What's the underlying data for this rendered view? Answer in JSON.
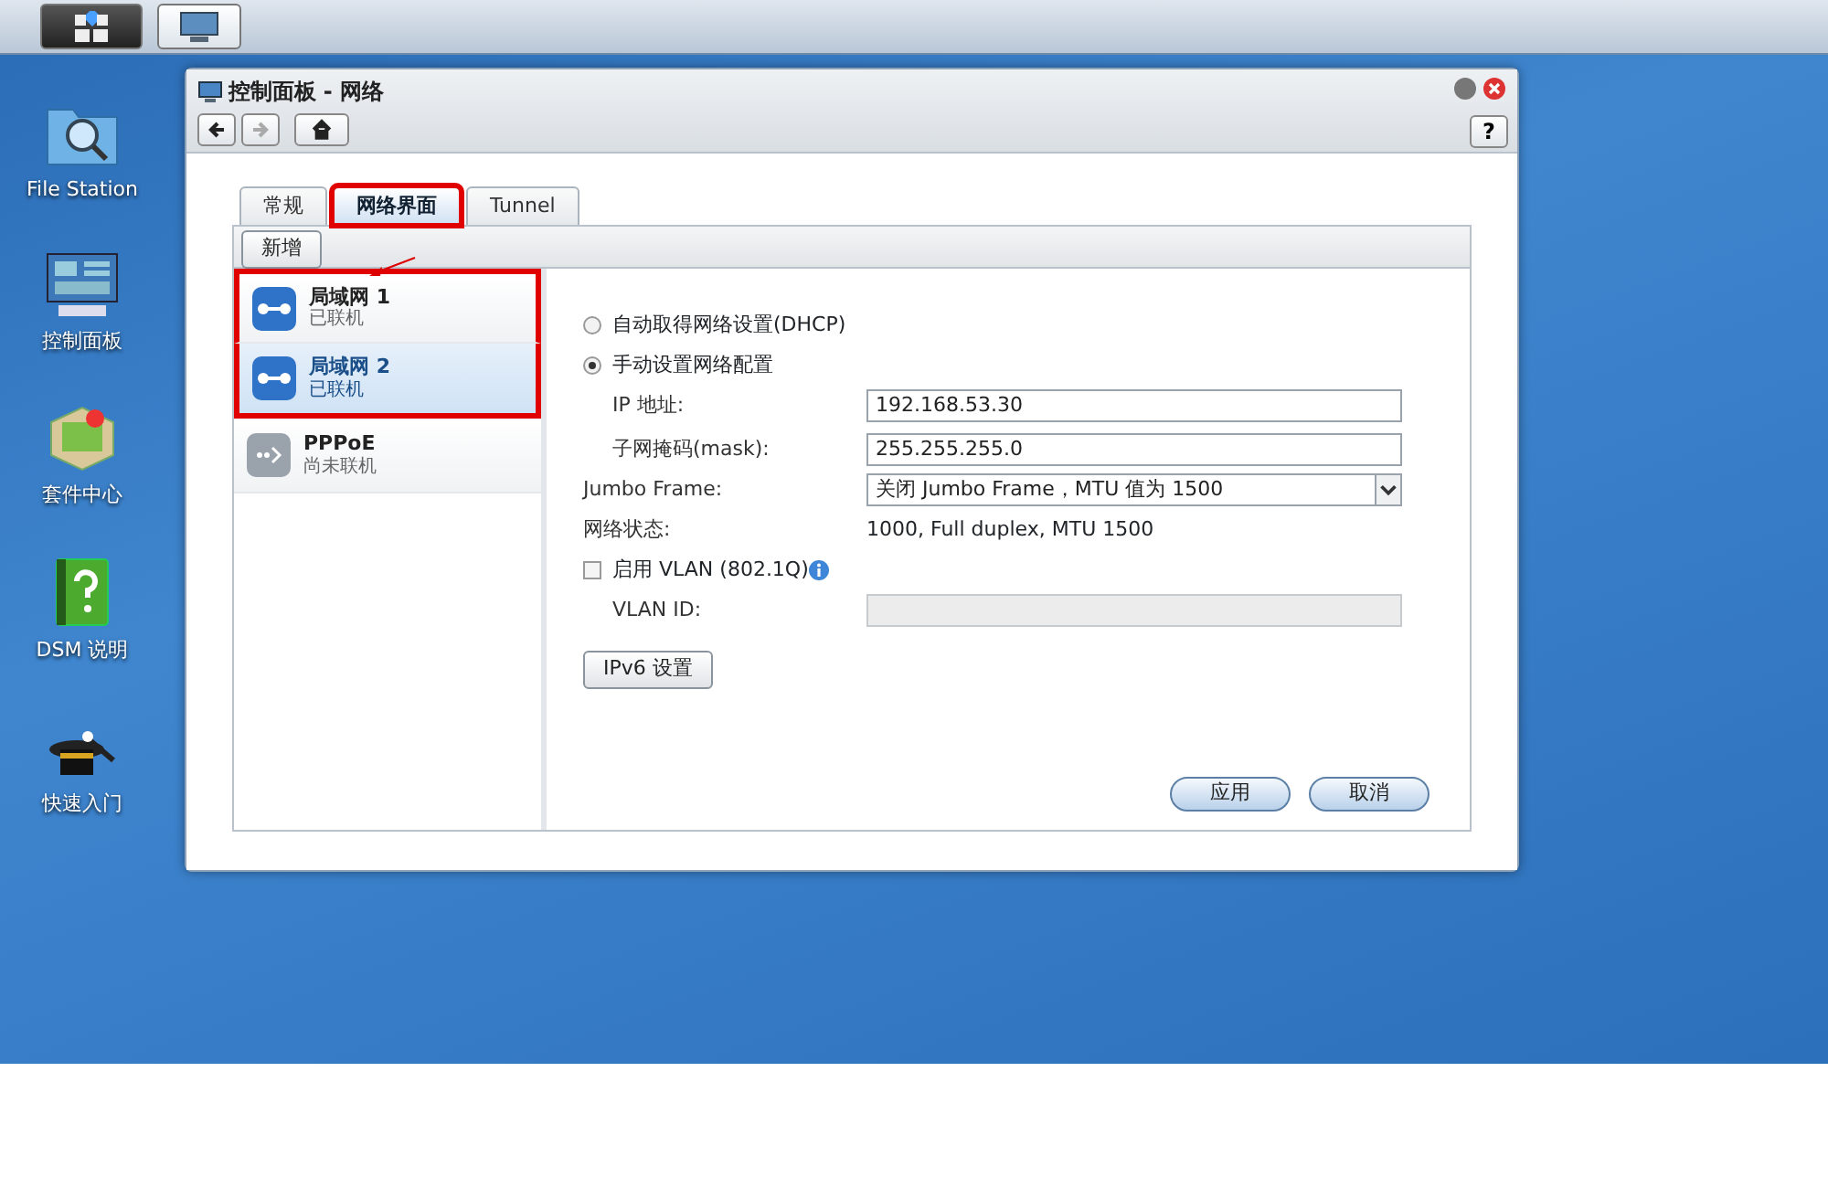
{
  "taskbar": {
    "buttons": [
      {
        "kind": "main-menu",
        "selected": true
      },
      {
        "kind": "control-panel",
        "selected": false
      }
    ]
  },
  "desktop_icons": [
    {
      "kind": "folder",
      "label": "File Station"
    },
    {
      "kind": "panel",
      "label": "控制面板"
    },
    {
      "kind": "package",
      "label": "套件中心"
    },
    {
      "kind": "help",
      "label": "DSM 说明"
    },
    {
      "kind": "hat",
      "label": "快速入门"
    }
  ],
  "window": {
    "title": "控制面板 - 网络",
    "help_button": "?",
    "nav": [
      {
        "kind": "back",
        "disabled": false
      },
      {
        "kind": "forward",
        "disabled": true
      },
      {
        "kind": "home",
        "disabled": false
      }
    ],
    "tabs": [
      {
        "label": "常规",
        "selected": false,
        "highlighted": false
      },
      {
        "label": "网络界面",
        "selected": true,
        "highlighted": true
      },
      {
        "label": "Tunnel",
        "selected": false,
        "highlighted": false
      }
    ],
    "toolbar": {
      "create_button": "新增"
    },
    "interfaces": [
      {
        "name": "局域网 1",
        "status": "已联机",
        "connected": true,
        "selected": false,
        "highlighted": true
      },
      {
        "name": "局域网 2",
        "status": "已联机",
        "connected": true,
        "selected": true,
        "highlighted": true
      },
      {
        "name": "PPPoE",
        "status": "尚未联机",
        "connected": false,
        "selected": false,
        "highlighted": false
      }
    ],
    "form": {
      "dhcp_option": {
        "label": "自动取得网络设置(DHCP)",
        "selected": false
      },
      "manual_option": {
        "label": "手动设置网络配置",
        "selected": true
      },
      "ip": {
        "label": "IP 地址:",
        "value": "192.168.53.30"
      },
      "mask": {
        "label": "子网掩码(mask):",
        "value": "255.255.255.0"
      },
      "jumbo": {
        "label": "Jumbo Frame:",
        "value": "关闭 Jumbo Frame，MTU 值为 1500"
      },
      "status": {
        "label": "网络状态:",
        "value": "1000, Full duplex, MTU 1500"
      },
      "vlan": {
        "label": "启用 VLAN (802.1Q)",
        "checked": false
      },
      "vlan_id": {
        "label": "VLAN ID:",
        "disabled": true
      },
      "ipv6_button": "IPv6 设置"
    },
    "buttons": [
      {
        "label": "应用"
      },
      {
        "label": "取消"
      }
    ]
  }
}
